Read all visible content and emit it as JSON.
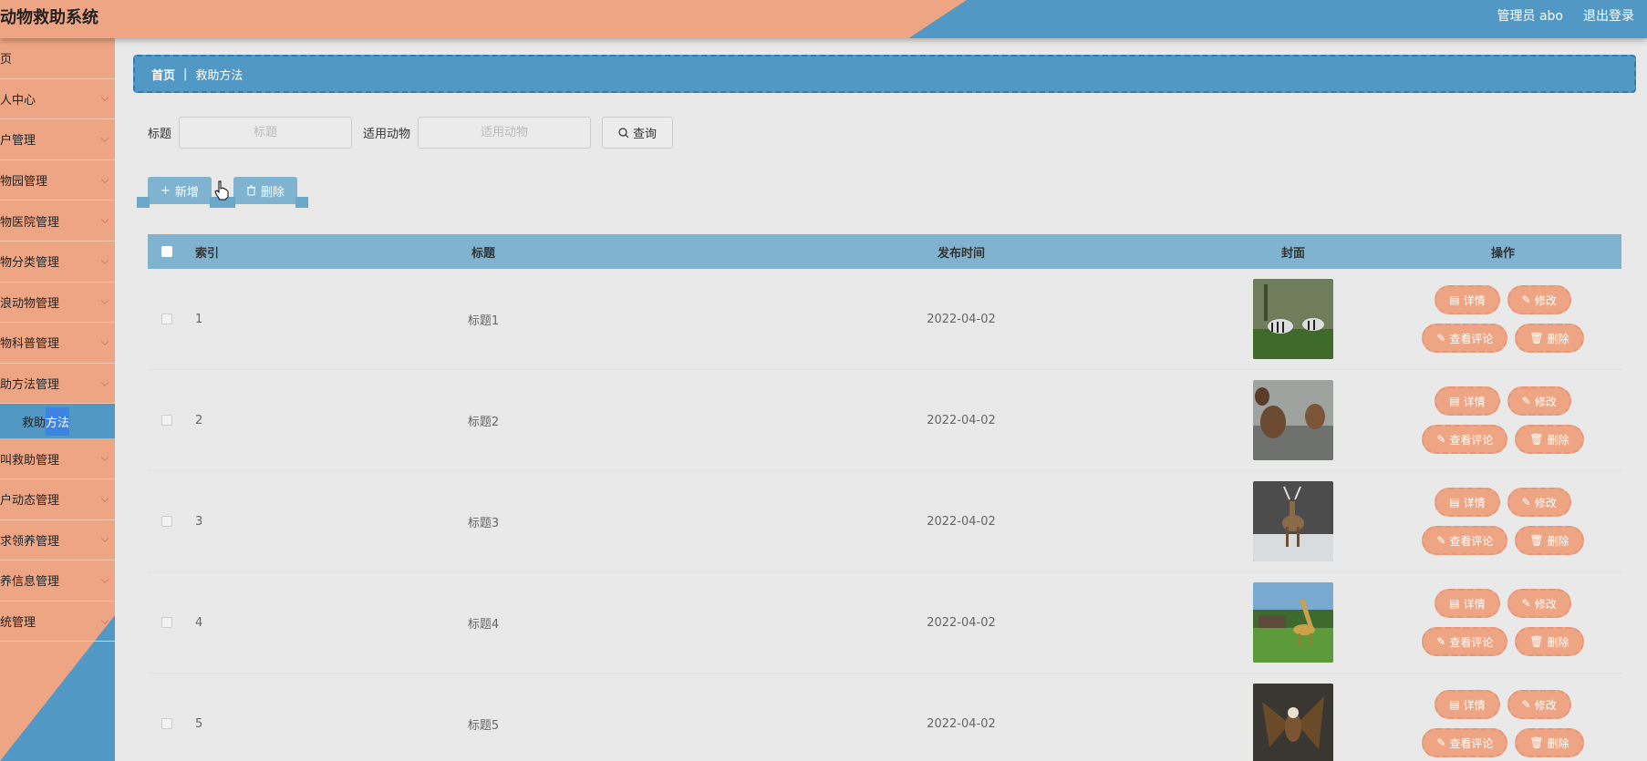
{
  "app": {
    "title": "动物救助系统"
  },
  "header": {
    "user": "管理员 abo",
    "logout": "退出登录"
  },
  "sidebar": {
    "items": [
      {
        "label": "页",
        "chevron": false
      },
      {
        "label": "人中心",
        "chevron": true
      },
      {
        "label": "户管理",
        "chevron": true
      },
      {
        "label": "物园管理",
        "chevron": true
      },
      {
        "label": "物医院管理",
        "chevron": true
      },
      {
        "label": "物分类管理",
        "chevron": true
      },
      {
        "label": "浪动物管理",
        "chevron": true
      },
      {
        "label": "物科普管理",
        "chevron": true
      },
      {
        "label": "助方法管理",
        "chevron": true
      },
      {
        "label": "叫救助管理",
        "chevron": true
      },
      {
        "label": "户动态管理",
        "chevron": true
      },
      {
        "label": "求领养管理",
        "chevron": true
      },
      {
        "label": "养信息管理",
        "chevron": true
      },
      {
        "label": "统管理",
        "chevron": true
      }
    ],
    "sub_item": {
      "label_a": "救助",
      "label_b": "方法"
    }
  },
  "breadcrumb": {
    "home": "首页",
    "sep": "|",
    "current": "救助方法"
  },
  "search": {
    "title_label": "标题",
    "title_placeholder": "标题",
    "animal_label": "适用动物",
    "animal_placeholder": "适用动物",
    "query_label": "查询"
  },
  "actions": {
    "add": "新增",
    "delete": "删除"
  },
  "table": {
    "headers": {
      "index": "索引",
      "title": "标题",
      "date": "发布时间",
      "cover": "封面",
      "ops": "操作"
    },
    "op_labels": {
      "detail": "详情",
      "edit": "修改",
      "comments": "查看评论",
      "delete": "删除"
    },
    "rows": [
      {
        "index": "1",
        "title": "标题1",
        "date": "2022-04-02",
        "cover": "zebras"
      },
      {
        "index": "2",
        "title": "标题2",
        "date": "2022-04-02",
        "cover": "bears"
      },
      {
        "index": "3",
        "title": "标题3",
        "date": "2022-04-02",
        "cover": "deer"
      },
      {
        "index": "4",
        "title": "标题4",
        "date": "2022-04-02",
        "cover": "giraffe"
      },
      {
        "index": "5",
        "title": "标题5",
        "date": "2022-04-02",
        "cover": "eagle"
      }
    ]
  },
  "colors": {
    "orange": "#eea584",
    "blue": "#5199c4",
    "header_row": "#7fb3cf"
  }
}
